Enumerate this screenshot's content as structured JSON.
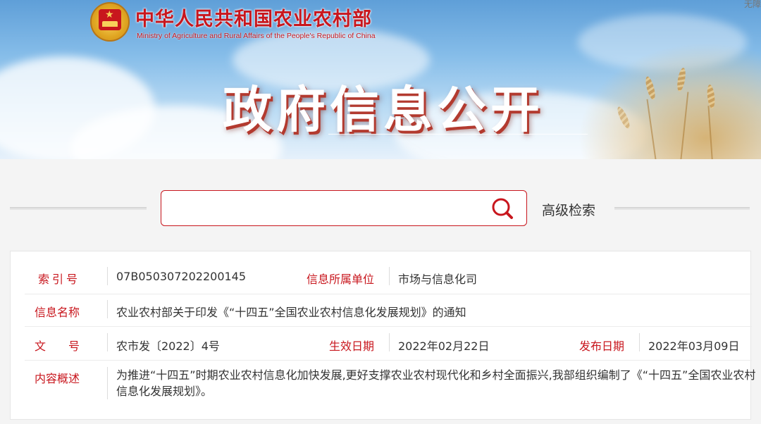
{
  "header": {
    "site_title": "中华人民共和国农业农村部",
    "site_subtitle": "Ministry of Agriculture and Rural Affairs of the People's Republic of China",
    "accessibility": "无障",
    "banner_title": "政府信息公开",
    "emblem_icon": "national-emblem-icon",
    "colors": {
      "brand_red": "#c8161d",
      "sky_blue": "#86bde9"
    }
  },
  "search": {
    "placeholder": "",
    "value": "",
    "icon": "search-icon",
    "advanced_label": "高级检索"
  },
  "info": {
    "index_label": "索引号",
    "index_value": "07B050307202200145",
    "dept_label": "信息所属单位",
    "dept_value": "市场与信息化司",
    "name_label": "信息名称",
    "name_value": "农业农村部关于印发《“十四五”全国农业农村信息化发展规划》的通知",
    "doc_label": "文　　号",
    "doc_value": "农市发〔2022〕4号",
    "effective_label": "生效日期",
    "effective_value": "2022年02月22日",
    "publish_label": "发布日期",
    "publish_value": "2022年03月09日",
    "summary_label": "内容概述",
    "summary_value": "为推进“十四五”时期农业农村信息化加快发展,更好支撑农业农村现代化和乡村全面振兴,我部组织编制了《“十四五”全国农业农村信息化发展规划》。"
  }
}
